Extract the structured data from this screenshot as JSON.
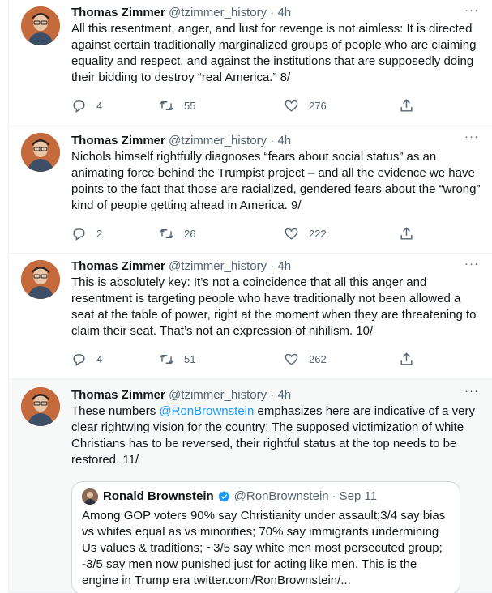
{
  "tweets": [
    {
      "name": "Thomas Zimmer",
      "handle": "@tzimmer_history",
      "sep": "·",
      "time": "4h",
      "more": "···",
      "text": "All this resentment, anger, and lust for revenge is not aimless: It is directed against certain traditionally marginalized groups of people who are claiming equality and respect, and against the institutions that are supposedly doing their bidding to destroy “real America.” 8/",
      "replies": "4",
      "retweets": "55",
      "likes": "276"
    },
    {
      "name": "Thomas Zimmer",
      "handle": "@tzimmer_history",
      "sep": "·",
      "time": "4h",
      "more": "···",
      "text": "Nichols himself rightfully diagnoses “fears about social status” as an animating force behind the Trumpist project – and all the evidence we have points to the fact that those are racialized, gendered fears about the “wrong” kind of people getting ahead in America. 9/",
      "replies": "2",
      "retweets": "26",
      "likes": "222"
    },
    {
      "name": "Thomas Zimmer",
      "handle": "@tzimmer_history",
      "sep": "·",
      "time": "4h",
      "more": "···",
      "text": "This is absolutely key: It’s not a coincidence that all this anger and resentment is targeting people who have traditionally not been allowed a seat at the table of power, right at the moment when they are threatening to claim their seat. That’s not an expression of nihilism. 10/",
      "replies": "4",
      "retweets": "51",
      "likes": "262"
    },
    {
      "name": "Thomas Zimmer",
      "handle": "@tzimmer_history",
      "sep": "·",
      "time": "4h",
      "more": "···",
      "text_before": "These numbers ",
      "mention": "@RonBrownstein",
      "text_after": " emphasizes here are indicative of a very clear rightwing vision for the country: The supposed victimization of white Christians has to be reversed, their rightful status at the top needs to be restored. 11/"
    }
  ],
  "quote": {
    "name": "Ronald Brownstein",
    "handle": "@RonBrownstein",
    "sep": "·",
    "time": "Sep 11",
    "text": "Among GOP voters 90% say Christianity under assault;3/4 say bias vs whites equal as vs minorities; 70% say immigrants undermining Us values & traditions; ~3/5 say white men most persecuted group; -3/5 say men now punished just for acting like men. This is the engine in Trump era twitter.com/RonBrownstein/..."
  },
  "colors": {
    "accent": "#1d9bf0",
    "muted": "#536471",
    "text": "#0f1419",
    "shaded_bg": "#f7f9f9"
  },
  "icons": [
    "reply-icon",
    "retweet-icon",
    "like-icon",
    "share-icon",
    "more-icon",
    "verified-icon"
  ]
}
